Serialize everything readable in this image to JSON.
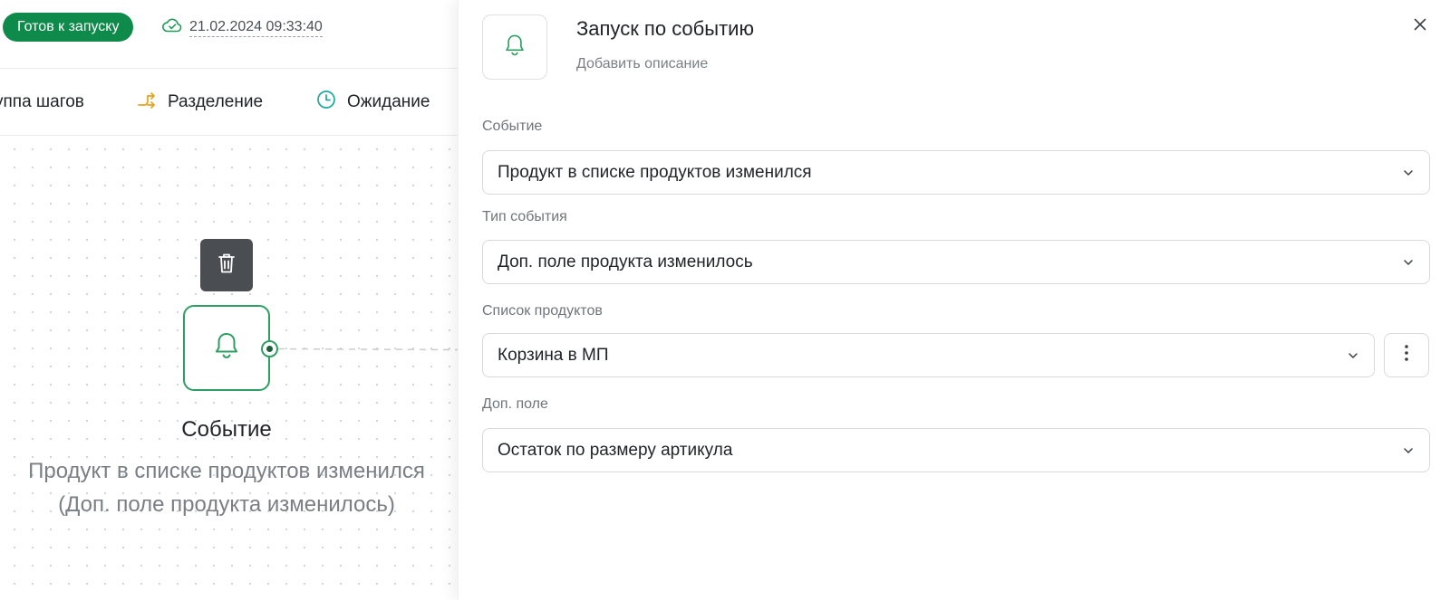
{
  "header": {
    "status_badge": "Готов к запуску",
    "saved_at": "21.02.2024 09:33:40"
  },
  "toolbar": {
    "items": [
      {
        "label": "уппа шагов"
      },
      {
        "label": "Разделение",
        "icon": "split-icon"
      },
      {
        "label": "Ожидание",
        "icon": "clock-icon"
      }
    ]
  },
  "canvas": {
    "node": {
      "icon": "bell-icon",
      "title": "Событие",
      "description": "Продукт в списке продуктов изменился (Доп. поле продукта изменилось)"
    }
  },
  "panel": {
    "title": "Запуск по событию",
    "description_placeholder": "Добавить описание",
    "fields": [
      {
        "label": "Событие",
        "value": "Продукт в списке продуктов изменился"
      },
      {
        "label": "Тип события",
        "value": "Доп. поле продукта изменилось"
      },
      {
        "label": "Список продуктов",
        "value": "Корзина в МП"
      },
      {
        "label": "Доп. поле",
        "value": "Остаток по размеру артикула"
      }
    ]
  },
  "colors": {
    "accent_green": "#2e9e62",
    "badge_green": "#0e8a4a",
    "split_orange": "#e7a21b",
    "clock_teal": "#1fa89b",
    "delete_bg": "#4a4d51"
  }
}
